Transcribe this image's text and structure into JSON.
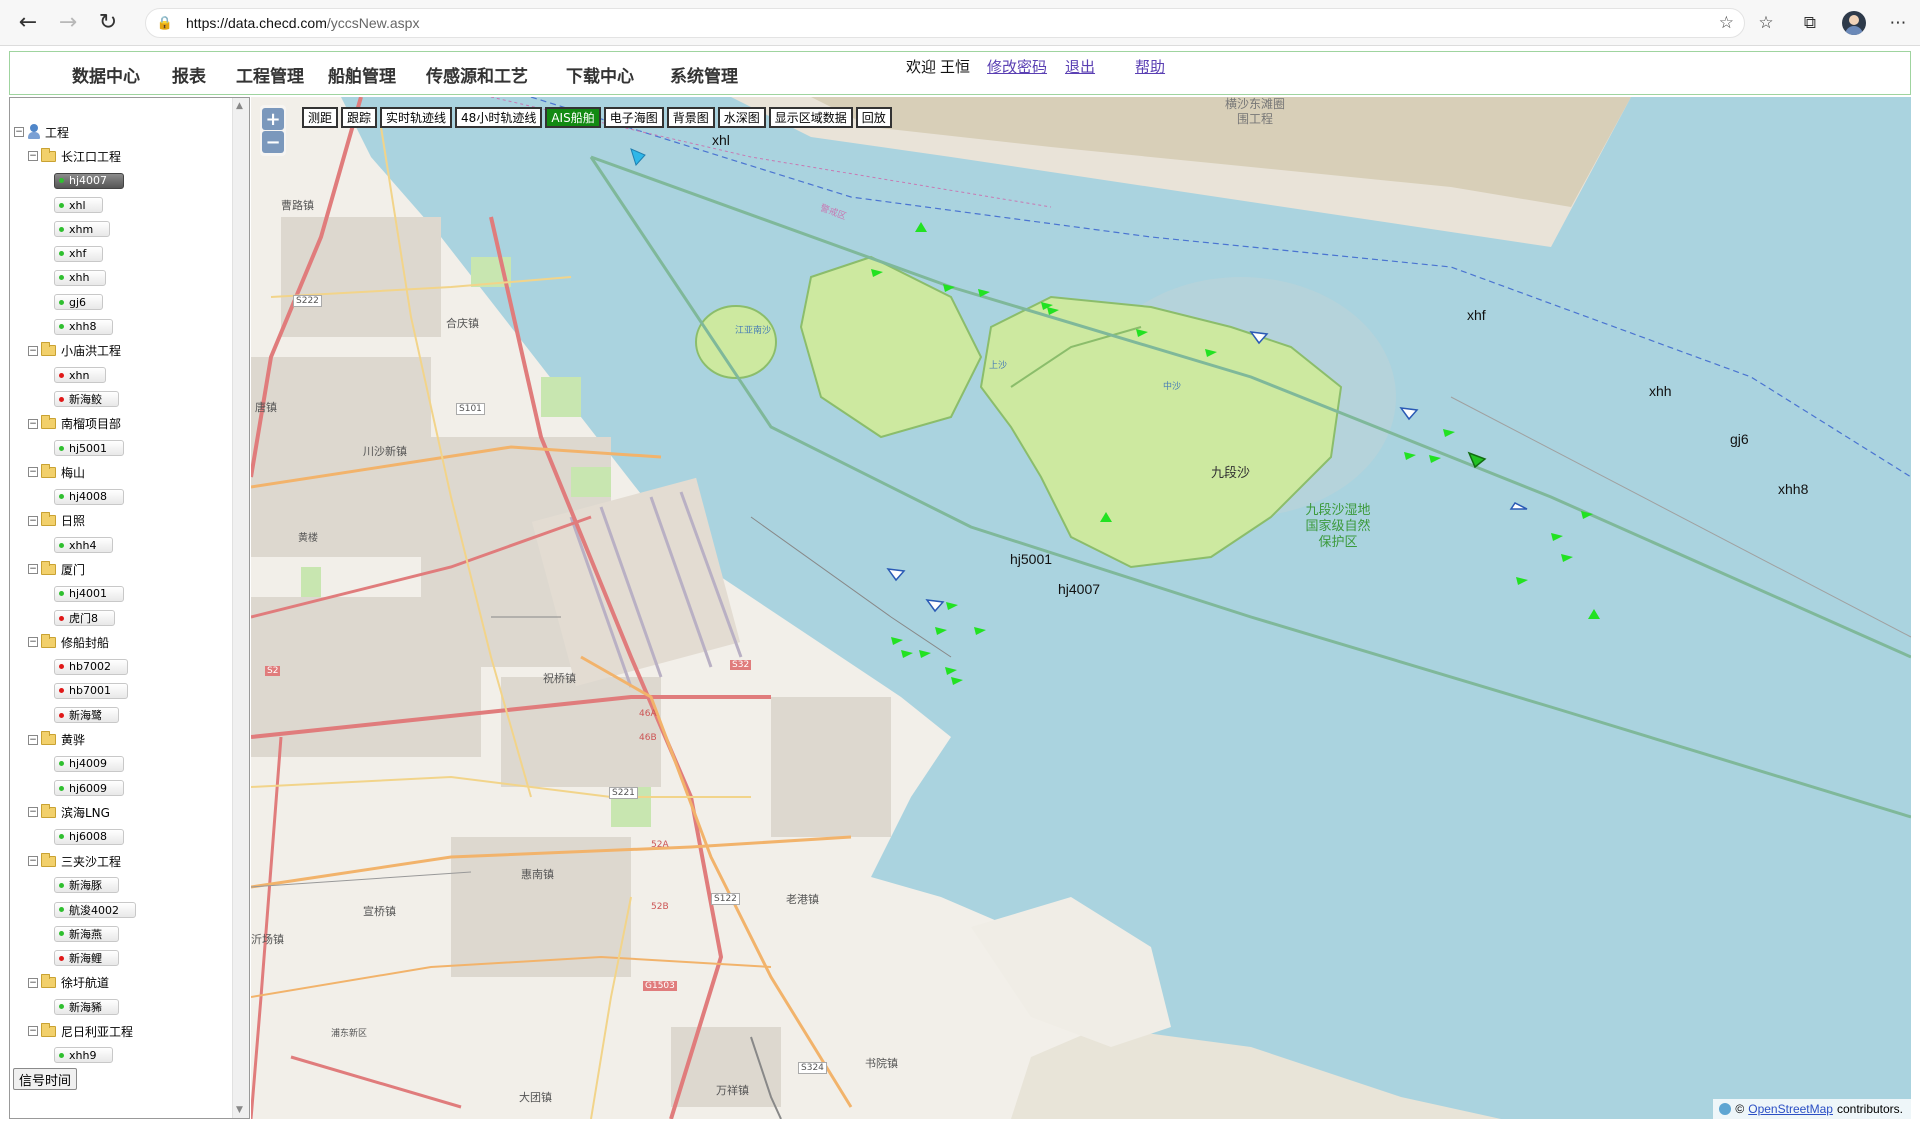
{
  "browser": {
    "url_host": "https://data.checd.com",
    "url_path": "/yccsNew.aspx"
  },
  "header": {
    "menu": [
      "数据中心",
      "报表",
      "工程管理",
      "船舶管理",
      "传感源和工艺",
      "下载中心",
      "系统管理"
    ],
    "welcome_label": "欢迎",
    "user_name": "王恒",
    "links": [
      "修改密码",
      "退出",
      "帮助"
    ]
  },
  "tree": {
    "root": "工程",
    "groups": [
      {
        "name": "长江口工程",
        "items": [
          {
            "label": "hj4007",
            "status": "active"
          },
          {
            "label": "xhl",
            "status": "green"
          },
          {
            "label": "xhm",
            "status": "green"
          },
          {
            "label": "xhf",
            "status": "green"
          },
          {
            "label": "xhh",
            "status": "green"
          },
          {
            "label": "gj6",
            "status": "green"
          },
          {
            "label": "xhh8",
            "status": "green"
          }
        ]
      },
      {
        "name": "小庙洪工程",
        "items": [
          {
            "label": "xhn",
            "status": "red"
          },
          {
            "label": "新海鲛",
            "status": "red"
          }
        ]
      },
      {
        "name": "南榴项目部",
        "items": [
          {
            "label": "hj5001",
            "status": "green"
          }
        ]
      },
      {
        "name": "梅山",
        "items": [
          {
            "label": "hj4008",
            "status": "green"
          }
        ]
      },
      {
        "name": "日照",
        "items": [
          {
            "label": "xhh4",
            "status": "green"
          }
        ]
      },
      {
        "name": "厦门",
        "items": [
          {
            "label": "hj4001",
            "status": "green"
          },
          {
            "label": "虎门8",
            "status": "red"
          }
        ]
      },
      {
        "name": "修船封船",
        "items": [
          {
            "label": "hb7002",
            "status": "red"
          },
          {
            "label": "hb7001",
            "status": "red"
          },
          {
            "label": "新海鹭",
            "status": "red"
          }
        ]
      },
      {
        "name": "黄骅",
        "items": [
          {
            "label": "hj4009",
            "status": "green"
          },
          {
            "label": "hj6009",
            "status": "green"
          }
        ]
      },
      {
        "name": "滨海LNG",
        "items": [
          {
            "label": "hj6008",
            "status": "green"
          }
        ]
      },
      {
        "name": "三夹沙工程",
        "items": [
          {
            "label": "新海豚",
            "status": "green"
          },
          {
            "label": "航浚4002",
            "status": "green"
          },
          {
            "label": "新海燕",
            "status": "green"
          },
          {
            "label": "新海鲤",
            "status": "red"
          }
        ]
      },
      {
        "name": "徐圩航道",
        "items": [
          {
            "label": "新海豨",
            "status": "green"
          }
        ]
      },
      {
        "name": "尼日利亚工程",
        "items": [
          {
            "label": "xhh9",
            "status": "green"
          }
        ]
      }
    ],
    "signal_button": "信号时间"
  },
  "map": {
    "zoom_in": "+",
    "zoom_out": "−",
    "toolbar": [
      {
        "label": "测距",
        "active": false
      },
      {
        "label": "跟踪",
        "active": false
      },
      {
        "label": "实时轨迹线",
        "active": false
      },
      {
        "label": "48小时轨迹线",
        "active": false
      },
      {
        "label": "AIS船舶",
        "active": true
      },
      {
        "label": "电子海图",
        "active": false
      },
      {
        "label": "背景图",
        "active": false
      },
      {
        "label": "水深图",
        "active": false
      },
      {
        "label": "显示区域数据",
        "active": false
      },
      {
        "label": "回放",
        "active": false
      }
    ],
    "place_labels": [
      "曹路镇",
      "合庆镇",
      "唐镇",
      "川沙新镇",
      "黄楼",
      "祝桥镇",
      "惠南镇",
      "宣桥镇",
      "老港镇",
      "书院镇",
      "万祥镇",
      "大团镇",
      "沂场镇",
      "浦东新区"
    ],
    "road_labels": [
      "S222",
      "S101",
      "S2",
      "S32",
      "S221",
      "S122",
      "G1503",
      "S324",
      "52A",
      "52B",
      "46A",
      "46B"
    ],
    "islands": [
      "九段沙",
      "上沙",
      "中沙",
      "江亚南沙"
    ],
    "reserve_label": "九段沙湿地国家级自然保护区",
    "project_label": "横沙东滩圈围工程",
    "channel_label": "警戒区",
    "ships": [
      "xhl",
      "xhf",
      "xhh",
      "gj6",
      "xhh8",
      "hj5001",
      "hj4007"
    ],
    "attribution_prefix": "©",
    "attribution_link": "OpenStreetMap",
    "attribution_suffix": "contributors."
  },
  "colors": {
    "water": "#aad3df",
    "land": "#f2efe9",
    "wetland": "#cde9a0",
    "active_button": "#138a13",
    "ais_ship": "#22e222",
    "tracked_ship": "#ffffff",
    "xhl_ship": "#2fb7e8"
  }
}
